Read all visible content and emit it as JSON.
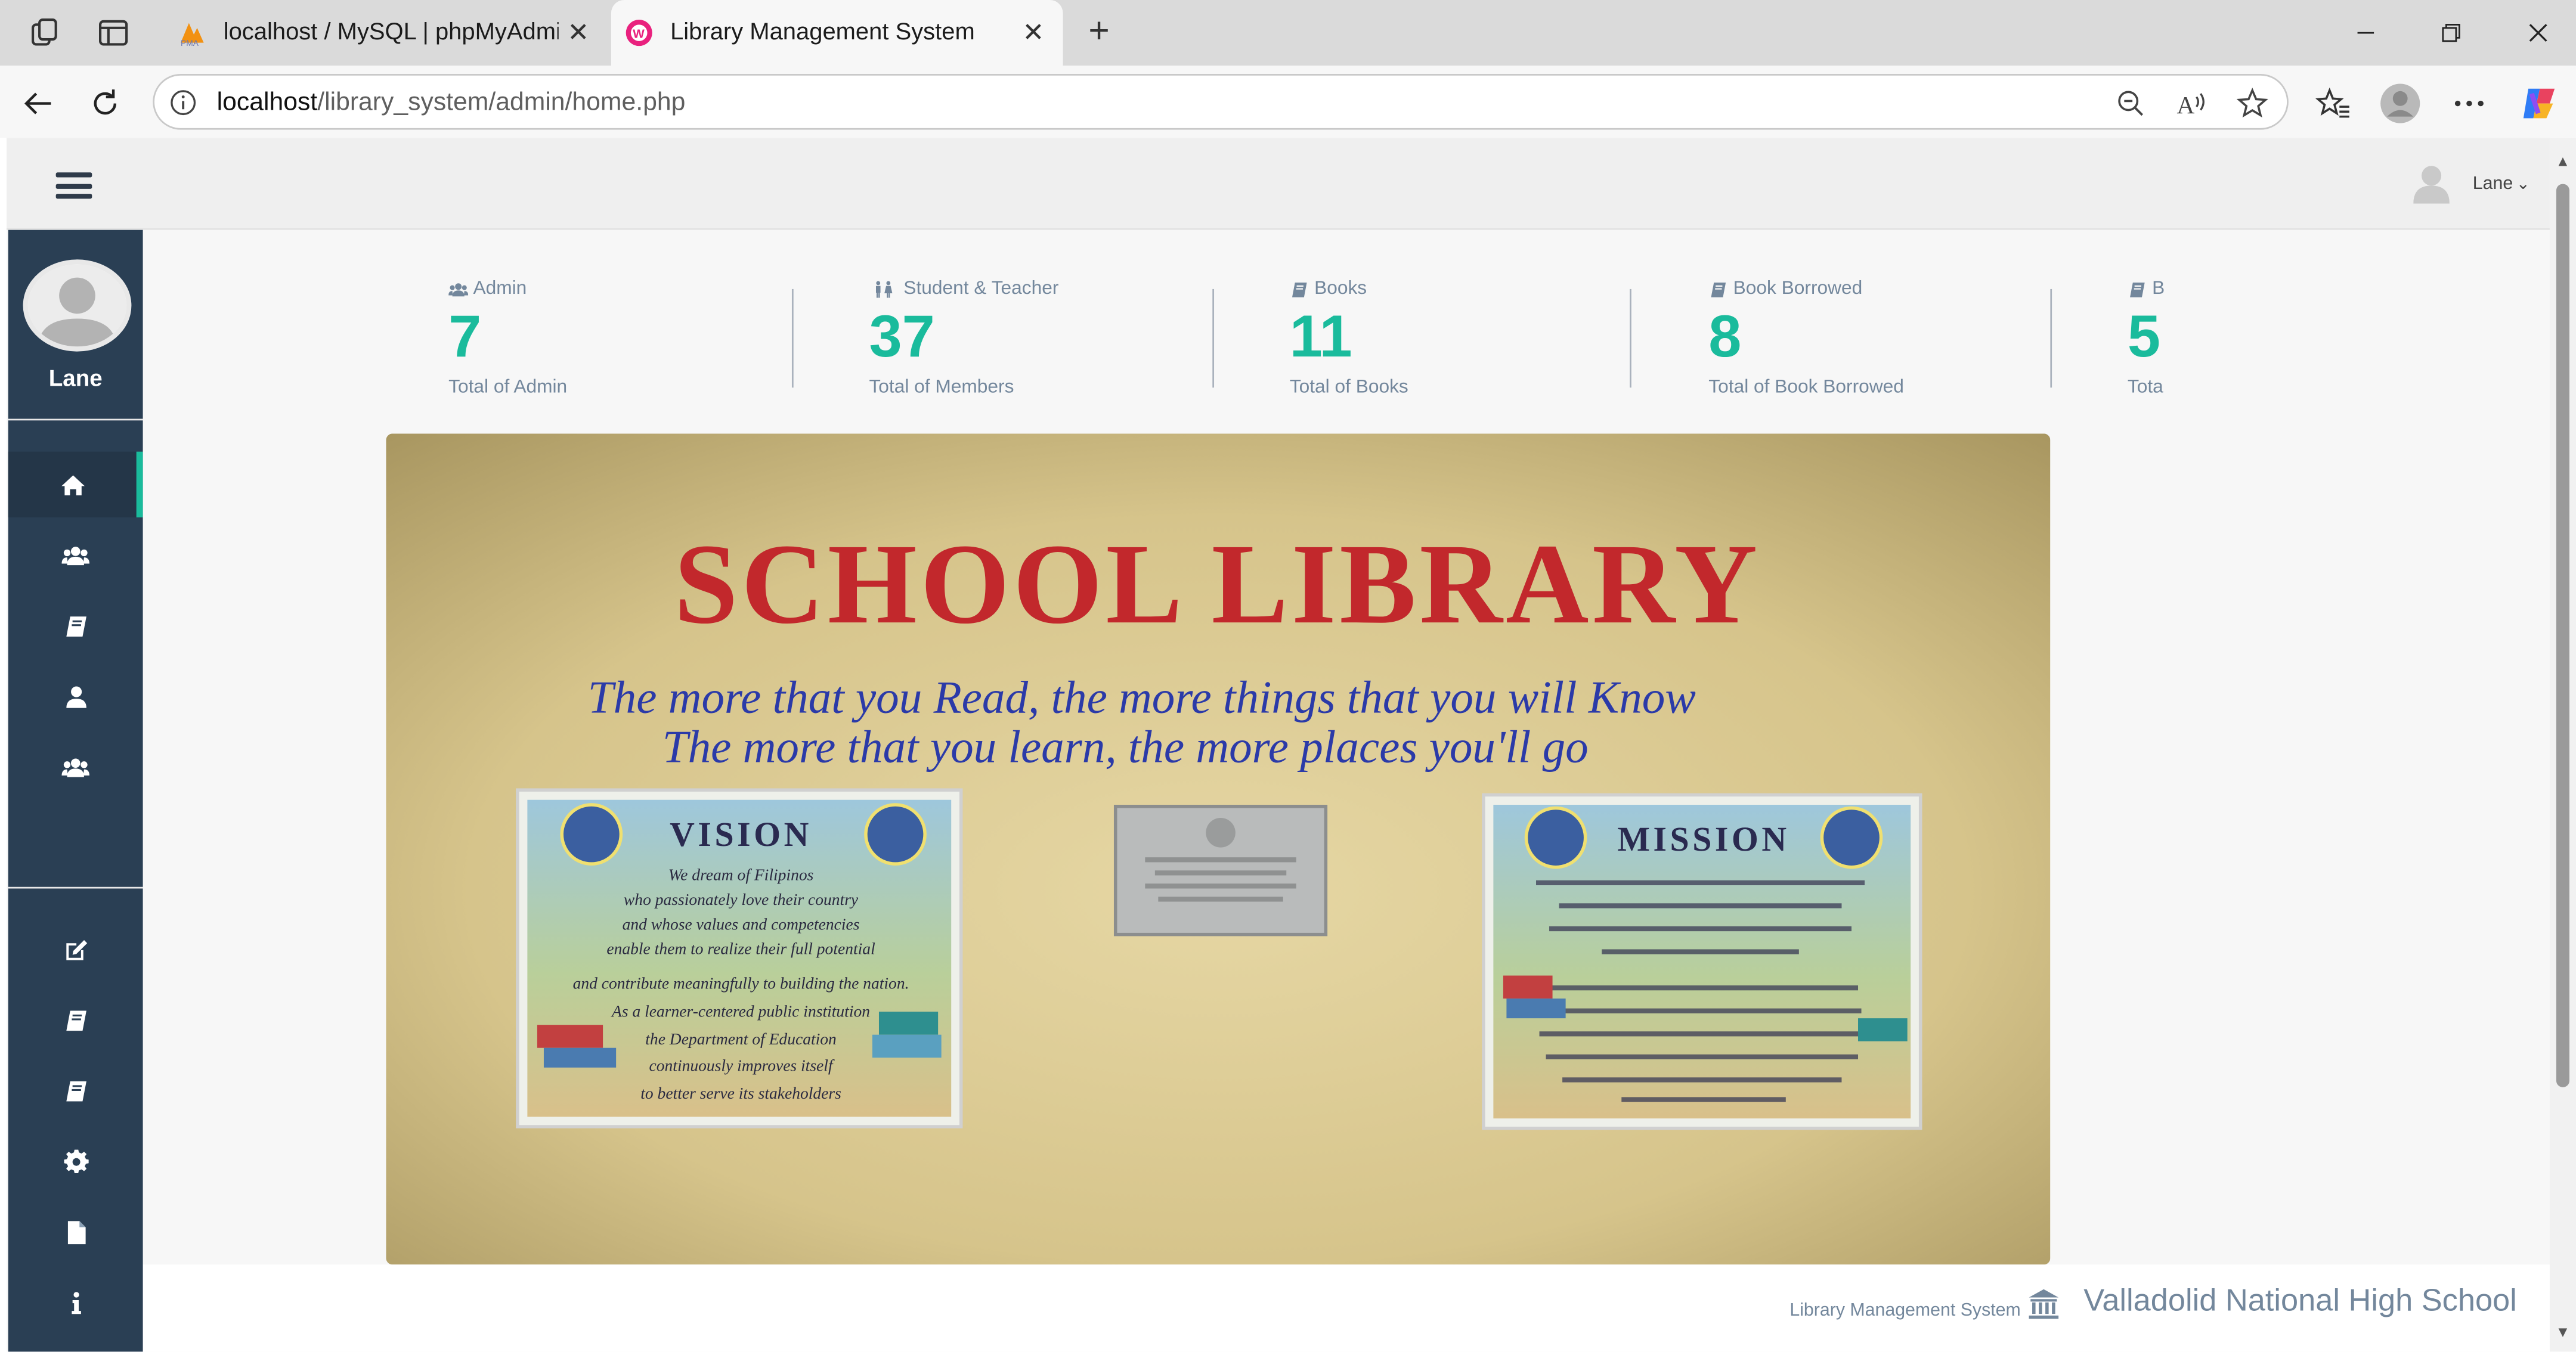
{
  "browser": {
    "tabs": [
      {
        "title": "localhost / MySQL | phpMyAdmin",
        "active": false,
        "favicon": "phpmyadmin-icon"
      },
      {
        "title": "Library Management System",
        "active": true,
        "favicon": "wamp-icon"
      }
    ],
    "url_host": "localhost",
    "url_path": "/library_system/admin/home.php"
  },
  "header": {
    "user_name": "Lane",
    "user_caret": "⌄"
  },
  "sidebar": {
    "profile_name": "Lane",
    "menu_icons": [
      "home-icon",
      "users-icon",
      "book-icon",
      "user-icon",
      "users-icon"
    ],
    "bottom_icons": [
      "edit-icon",
      "book-icon",
      "book-icon",
      "gear-icon",
      "file-icon",
      "info-icon"
    ]
  },
  "stats": [
    {
      "label": "Admin",
      "value": "7",
      "caption": "Total of Admin",
      "icon": "users-icon"
    },
    {
      "label": "Student & Teacher",
      "value": "37",
      "caption": "Total of Members",
      "icon": "male-female-icon"
    },
    {
      "label": "Books",
      "value": "11",
      "caption": "Total of Books",
      "icon": "book-icon"
    },
    {
      "label": "Book Borrowed",
      "value": "8",
      "caption": "Total of Book Borrowed",
      "icon": "book-icon"
    },
    {
      "label": "B",
      "value": "5",
      "caption": "Tota",
      "icon": "book-icon"
    }
  ],
  "banner": {
    "heading": "SCHOOL LIBRARY",
    "line1": "The more that you Read, the more things that you will Know",
    "line2": "The more that you learn, the more places you'll go",
    "vision_title": "VISION",
    "vision_text": [
      "We dream of Filipinos",
      "who passionately love their country",
      "and whose values and competencies",
      "enable them to realize their full potential",
      "and contribute meaningfully to building the nation.",
      "As a learner-centered public institution",
      "the Department of Education",
      "continuously improves itself",
      "to better serve its stakeholders"
    ],
    "mission_title": "MISSION"
  },
  "footer": {
    "system_name": "Library Management System",
    "school_name": "Valladolid National High School"
  },
  "colors": {
    "accent": "#1abb9c",
    "sidebar": "#2a3f54",
    "muted_text": "#73879c"
  }
}
